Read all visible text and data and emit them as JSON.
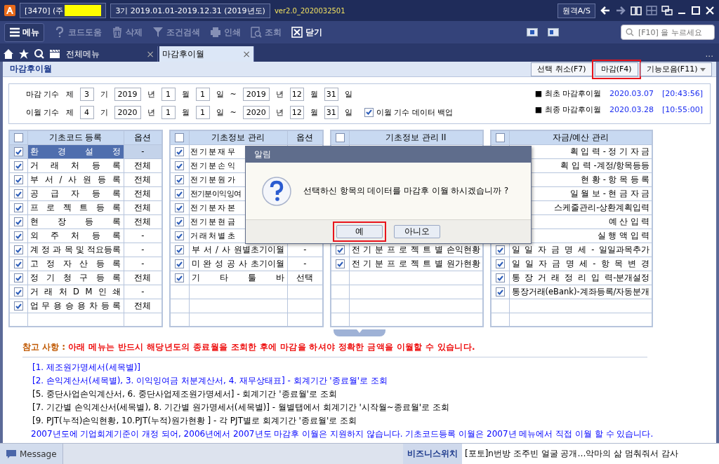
{
  "title_bar": {
    "company": "[3470] (주",
    "period": "3기 2019.01.01-2019.12.31 (2019년도)",
    "version": "ver2.0_2020032501",
    "remote_button": "원격A/S"
  },
  "toolbar": {
    "menu": "메뉴",
    "buttons": [
      {
        "kind": "help",
        "label": "코드도움",
        "disabled": true
      },
      {
        "kind": "delete",
        "label": "삭제",
        "disabled": true
      },
      {
        "kind": "filter",
        "label": "조건검색",
        "disabled": true
      },
      {
        "kind": "print",
        "label": "인쇄",
        "disabled": true
      },
      {
        "kind": "search",
        "label": "조회",
        "disabled": true
      },
      {
        "kind": "close",
        "label": "닫기",
        "disabled": false
      }
    ],
    "search": {
      "placeholder": "[F10] 을 누르세요"
    }
  },
  "tabs": [
    {
      "label": "전체메뉴",
      "selected": false,
      "close": "×"
    },
    {
      "label": "마감후이월",
      "selected": true,
      "close": "×"
    }
  ],
  "tab_more": "...",
  "section": {
    "title": "마감후이월",
    "buttons": [
      {
        "label": "선택 취소(F7)",
        "highlighted": false
      },
      {
        "label": "마감(F4)",
        "highlighted": true
      },
      {
        "label": "기능모음(F11)",
        "highlighted": false,
        "dropdown": true
      }
    ]
  },
  "form": {
    "rows": [
      {
        "parts": [
          {
            "kind": "text",
            "text": "마감 기수"
          },
          {
            "kind": "text",
            "text": "제"
          },
          {
            "kind": "input",
            "value": "3"
          },
          {
            "kind": "text",
            "text": "기"
          },
          {
            "kind": "input",
            "value": "2019"
          },
          {
            "kind": "text",
            "text": "년"
          },
          {
            "kind": "input",
            "value": "1"
          },
          {
            "kind": "text",
            "text": "월"
          },
          {
            "kind": "input",
            "value": "1"
          },
          {
            "kind": "text",
            "text": "일"
          },
          {
            "kind": "text",
            "text": "~"
          },
          {
            "kind": "input",
            "value": "2019"
          },
          {
            "kind": "text",
            "text": "년"
          },
          {
            "kind": "input",
            "value": "12"
          },
          {
            "kind": "text",
            "text": "월"
          },
          {
            "kind": "input",
            "value": "31"
          },
          {
            "kind": "text",
            "text": "일"
          }
        ],
        "info": {
          "label": "■ 최초 마감후이월",
          "date": "2020.03.07",
          "time": "[20:43:56]"
        }
      },
      {
        "parts": [
          {
            "kind": "text",
            "text": "이월 기수"
          },
          {
            "kind": "text",
            "text": "제"
          },
          {
            "kind": "input",
            "value": "4"
          },
          {
            "kind": "text",
            "text": "기"
          },
          {
            "kind": "input",
            "value": "2020"
          },
          {
            "kind": "text",
            "text": "년"
          },
          {
            "kind": "input",
            "value": "1"
          },
          {
            "kind": "text",
            "text": "월"
          },
          {
            "kind": "input",
            "value": "1"
          },
          {
            "kind": "text",
            "text": "일"
          },
          {
            "kind": "text",
            "text": "~"
          },
          {
            "kind": "input",
            "value": "2020"
          },
          {
            "kind": "text",
            "text": "년"
          },
          {
            "kind": "input",
            "value": "12"
          },
          {
            "kind": "text",
            "text": "월"
          },
          {
            "kind": "input",
            "value": "31"
          },
          {
            "kind": "text",
            "text": "일"
          },
          {
            "kind": "checkbox",
            "label": "이월 기수 데이터 백업",
            "checked": true
          }
        ],
        "info": {
          "label": "■ 최종 마감후이월",
          "date": "2020.03.28",
          "time": "[10:55:00]"
        }
      }
    ]
  },
  "tables": [
    {
      "header": "기초코드 등록",
      "option_header": "옵션",
      "all_checked": false,
      "rows": [
        {
          "label": "환 경 설 정",
          "option": "-",
          "checked": true,
          "selected": true
        },
        {
          "label": "거 래 처 등 록",
          "option": "전체",
          "checked": true,
          "selected": false
        },
        {
          "label": "부 서 / 사 원 등 록",
          "option": "전체",
          "checked": true,
          "selected": false
        },
        {
          "label": "공 급 자 등 록",
          "option": "전체",
          "checked": true,
          "selected": false
        },
        {
          "label": "프 로 젝 트 등 록",
          "option": "전체",
          "checked": true,
          "selected": false
        },
        {
          "label": "현 장 등 록",
          "option": "전체",
          "checked": true,
          "selected": false
        },
        {
          "label": "외 주 처 등 록",
          "option": "-",
          "checked": true,
          "selected": false
        },
        {
          "label": "계 정 과 목 및 적요등록",
          "option": "-",
          "checked": true,
          "selected": false
        },
        {
          "label": "고 정 자 산 등 록",
          "option": "-",
          "checked": true,
          "selected": false
        },
        {
          "label": "정 기 청 구 등 록",
          "option": "전체",
          "checked": true,
          "selected": false
        },
        {
          "label": "거 래 처 D M 인 쇄",
          "option": "-",
          "checked": true,
          "selected": false
        },
        {
          "label": "업 무 용 승 용 차 등 록",
          "option": "전체",
          "checked": true,
          "selected": false
        }
      ]
    },
    {
      "header": "기초정보 관리",
      "option_header": "옵션",
      "all_checked": false,
      "rows": [
        {
          "kind": "covered-start",
          "label": "전 기 분 재 무",
          "checked": true
        },
        {
          "kind": "covered-start",
          "label": "전 기 분 손 익",
          "checked": true
        },
        {
          "kind": "covered-start",
          "label": "전 기 분 원 가",
          "checked": true
        },
        {
          "kind": "covered-start",
          "label": "전기분이익잉여",
          "checked": true
        },
        {
          "kind": "covered-start",
          "label": "전 기 분 자 본",
          "checked": true
        },
        {
          "kind": "covered-start",
          "label": "전 기 분 현 금",
          "checked": true
        },
        {
          "kind": "covered-start",
          "label": "거 래 처 별 초",
          "checked": true
        },
        {
          "kind": "row",
          "label": "부 서 / 사 원별초기이월",
          "option": "-",
          "checked": true,
          "selected": false
        },
        {
          "kind": "row",
          "label": "미 완 성 공 사 초기이월",
          "option": "-",
          "checked": true,
          "selected": false
        },
        {
          "kind": "row",
          "label": "기 타 툴 바",
          "option": "선택",
          "checked": true,
          "selected": false
        }
      ]
    },
    {
      "header": "기초정보 관리 II",
      "all_checked": false,
      "rows": [
        {
          "kind": "covered"
        },
        {
          "kind": "covered"
        },
        {
          "kind": "covered"
        },
        {
          "kind": "covered"
        },
        {
          "kind": "covered"
        },
        {
          "kind": "covered"
        },
        {
          "kind": "covered"
        },
        {
          "kind": "row",
          "label": "전 기 분 프 로 젝 트 별 손익현황",
          "checked": true,
          "selected": false
        },
        {
          "kind": "row",
          "label": "전 기 분 프 로 젝 트 별 원가현황",
          "checked": true,
          "selected": false
        }
      ]
    },
    {
      "header": "자금/예산 관리",
      "all_checked": false,
      "rows": [
        {
          "kind": "covered-end",
          "label": "획 입 력 - 정 기 자 금"
        },
        {
          "kind": "covered-end",
          "label": "획 입 력 -계정/항목등등"
        },
        {
          "kind": "covered-end",
          "label": "현 황 - 항 목 등 록"
        },
        {
          "kind": "covered-end",
          "label": "일 월 보 - 현 금 자 금"
        },
        {
          "kind": "covered-end",
          "label": "스케줄관리-상환계획입력"
        },
        {
          "kind": "covered-end",
          "label": "예 산 입 력"
        },
        {
          "kind": "covered-end",
          "label": "실 행 액 입 력"
        },
        {
          "kind": "row",
          "label": "일 일 자 금 명 세 - 일일과목추가",
          "checked": true,
          "selected": false
        },
        {
          "kind": "row",
          "label": "일 일 자 금 명 세 - 항 목 변 경",
          "checked": true,
          "selected": false
        },
        {
          "kind": "row",
          "label": "통 장 거 래 정 리 입 력-분개설정",
          "checked": true,
          "selected": false
        },
        {
          "kind": "row",
          "label": "통장거래(eBank)-계좌등록/자동분개",
          "checked": true,
          "selected": false
        }
      ]
    }
  ],
  "dialog": {
    "title": "알림",
    "message": "선택하신 항목의 데이터를 마감후 이월 하시겠습니까 ?",
    "buttons": [
      {
        "label": "예",
        "highlighted": true
      },
      {
        "label": "아니오",
        "highlighted": false
      }
    ]
  },
  "notes": {
    "heading": "참고 사항 :",
    "warning": "아래 메뉴는 반드시 해당년도의 종료월을 조회한 후에 마감을 하셔야 정확한 금액을 이월할 수 있습니다.",
    "lines": [
      {
        "text": "[1. 제조원가명세서(세목별)]",
        "color": "#0000ff"
      },
      {
        "text": "[2. 손익계산서(세목별), 3. 이익잉여금 처분계산서, 4. 재무상태표] - 회계기간 '종료월'로 조회",
        "color": "#0000ff"
      },
      {
        "text": "[5. 중단사업손익계산서, 6. 중단사업제조원가명세서] - 회계기간 '종료월'로 조회",
        "color": "#000000"
      },
      {
        "text": "[7. 기간별 손익계산서(세목별), 8. 기간별 원가명세서(세목별)] - 월별탭에서 회계기간 '시작월~종료월'로 조회",
        "color": "#000000"
      },
      {
        "text": "[9. PJT(누적)손익현황,  10.PJT(누적)원가현황 ] - 각 PJT별로 회계기간 '종료월'로 조회",
        "color": "#000000"
      },
      {
        "text": "2007년도에 기업회계기준이 개정 되어, 2006년에서 2007년도 마감후 이월은 지원하지 않습니다. 기초코드등록 이월은 2007년 메뉴에서 직접 이월 할 수 있습니다.",
        "color": "#0000ff"
      }
    ]
  },
  "status_bar": {
    "message": "Message",
    "switch_label": "비즈니스위치",
    "news": "[포토]n번방 조주빈 얼굴 공개…악마의 삶 멈춰줘서 감사"
  }
}
